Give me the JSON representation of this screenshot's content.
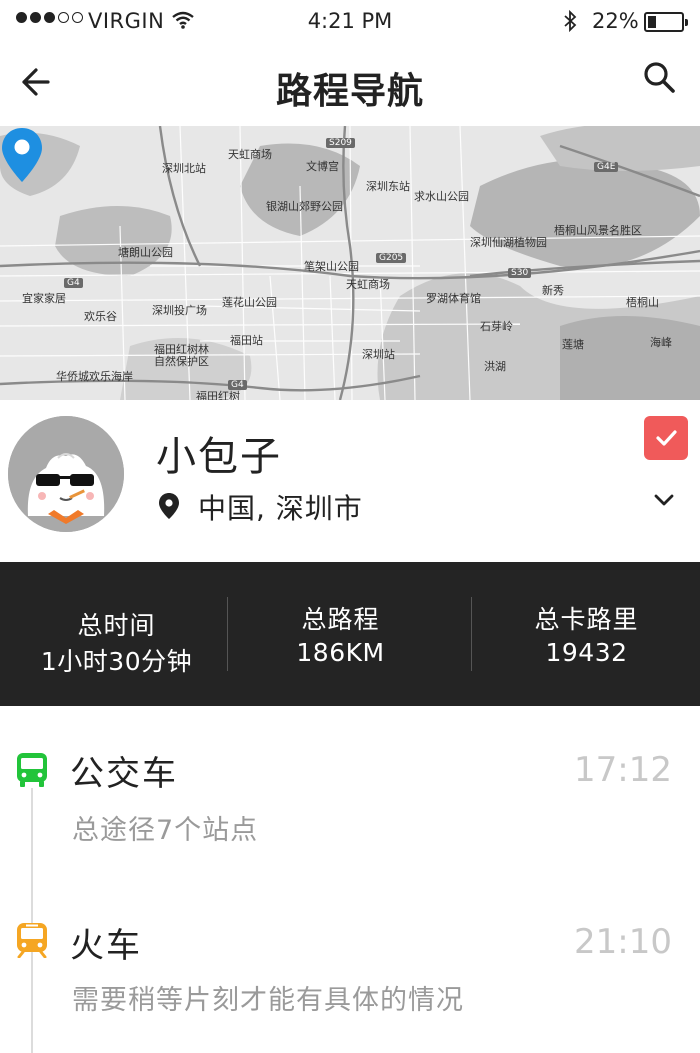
{
  "status_bar": {
    "signal_filled": 3,
    "signal_total": 5,
    "carrier": "VIRGIN",
    "time": "4:21 PM",
    "battery": "22%",
    "battery_level": 0.22
  },
  "nav": {
    "title": "路程导航",
    "back_icon": "arrow-left-icon",
    "search_icon": "search-icon"
  },
  "map": {
    "labels": [
      "天虹商场",
      "深圳北站",
      "文博宫",
      "深圳东站",
      "求水山公园",
      "梧桐山风景名胜区",
      "银湖山郊野公园",
      "塘朗山公园",
      "深圳仙湖植物园",
      "笔架山公园",
      "天虹商场",
      "罗湖体育馆",
      "宜家家居",
      "欢乐谷",
      "深圳投广场",
      "莲花山公园",
      "福田站",
      "福田红树林自然保护区",
      "华侨城欢乐海岸",
      "深圳站",
      "福田红树",
      "石芽岭",
      "莲塘",
      "洪湖",
      "梧桐山",
      "新秀",
      "海峰"
    ],
    "roads": [
      "G4",
      "G205",
      "S30",
      "G4E",
      "S209"
    ],
    "pin_color": "#1e8fe1"
  },
  "profile": {
    "name": "小包子",
    "location": "中国, 深圳市",
    "accent": "#f05a5a"
  },
  "stats": [
    {
      "label": "总时间",
      "value": "1小时30分钟"
    },
    {
      "label": "总路程",
      "value": "186KM"
    },
    {
      "label": "总卡路里",
      "value": "19432"
    }
  ],
  "timeline": [
    {
      "icon": "bus-icon",
      "color": "#22c43a",
      "title": "公交车",
      "time": "17:12",
      "desc": "总途径7个站点"
    },
    {
      "icon": "train-icon",
      "color": "#f5a623",
      "title": "火车",
      "time": "21:10",
      "desc": "需要稍等片刻才能有具体的情况"
    }
  ]
}
